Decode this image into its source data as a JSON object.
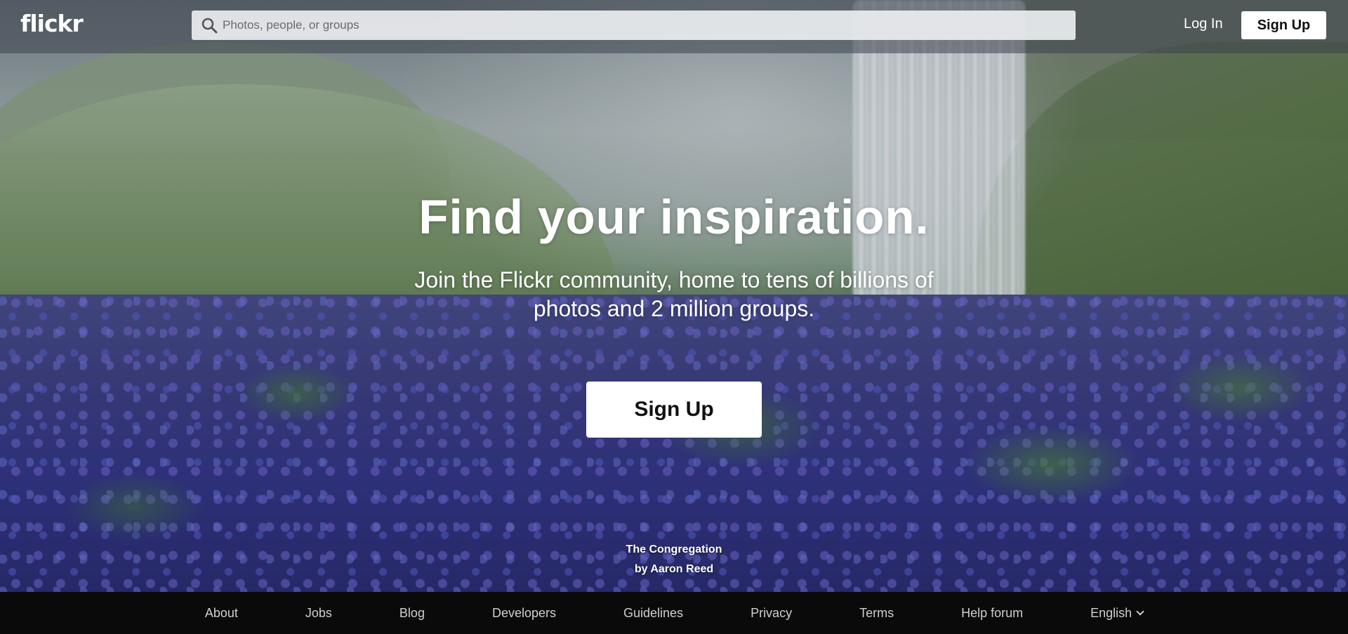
{
  "brand": {
    "logo_text": "flickr"
  },
  "header": {
    "search_placeholder": "Photos, people, or groups",
    "login_label": "Log In",
    "signup_label": "Sign Up"
  },
  "hero": {
    "headline": "Find your inspiration.",
    "subhead": "Join the Flickr community, home to tens of billions of photos and 2 million groups.",
    "signup_label": "Sign Up"
  },
  "photo_credit": {
    "title": "The Congregation",
    "author": "by Aaron Reed"
  },
  "footer": {
    "links": [
      "About",
      "Jobs",
      "Blog",
      "Developers",
      "Guidelines",
      "Privacy",
      "Terms",
      "Help forum"
    ],
    "language": "English"
  },
  "colors": {
    "topbar": "#3c424c",
    "footer": "#0a0a0a",
    "button_bg": "#ffffff",
    "button_text": "#111111"
  }
}
